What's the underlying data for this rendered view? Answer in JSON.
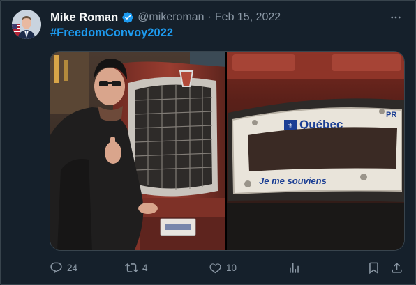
{
  "tweet": {
    "author_name": "Mike Roman",
    "handle": "@mikeroman",
    "separator": "·",
    "date": "Feb 15, 2022",
    "text": "#FreedomConvoy2022"
  },
  "media": {
    "left_photo": {
      "icon": "photo-man-with-truck"
    },
    "right_photo": {
      "icon": "photo-license-plate",
      "plate_province": "Québec",
      "plate_motto": "Je me souviens",
      "plate_corner": "PR"
    }
  },
  "actions": {
    "reply_count": "24",
    "retweet_count": "4",
    "like_count": "10"
  },
  "colors": {
    "background": "#15202b",
    "accent": "#1d9bf0",
    "muted": "#8b98a5",
    "border": "#38444d"
  }
}
